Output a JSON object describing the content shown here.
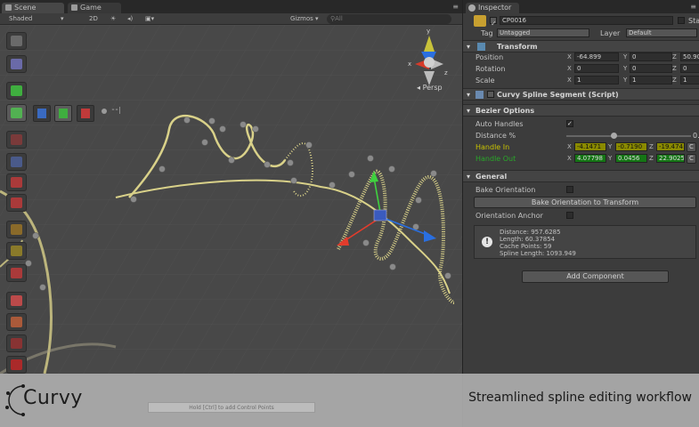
{
  "scene_tabs": {
    "scene": "Scene",
    "game": "Game"
  },
  "scene_toolbar": {
    "shading": "Shaded",
    "mode2d": "2D",
    "gizmos": "Gizmos ▾",
    "search_placeholder": "All"
  },
  "viewport": {
    "persp_label": "Persp"
  },
  "inspector": {
    "tab": "Inspector",
    "object_name": "CP0016",
    "static_label": "Sta",
    "tag_label": "Tag",
    "tag_value": "Untagged",
    "layer_label": "Layer",
    "layer_value": "Default",
    "transform": {
      "title": "Transform",
      "position": {
        "label": "Position",
        "x": "-64.899",
        "y": "0",
        "z": "50.90"
      },
      "rotation": {
        "label": "Rotation",
        "x": "0",
        "y": "0",
        "z": "0"
      },
      "scale": {
        "label": "Scale",
        "x": "1",
        "y": "1",
        "z": "1"
      }
    },
    "segment_title": "Curvy Spline Segment (Script)",
    "bezier": {
      "title": "Bezier Options",
      "auto_handles": "Auto Handles",
      "distance": "Distance %",
      "distance_value": "0.",
      "handle_in": {
        "label": "Handle In",
        "x": "-4.1471",
        "y": "-0.7190",
        "z": "-19.474"
      },
      "handle_out": {
        "label": "Handle Out",
        "x": "4.07798",
        "y": "0.0456",
        "z": "22.9025"
      }
    },
    "general": {
      "title": "General",
      "bake_orientation": "Bake Orientation",
      "bake_button": "Bake Orientation to Transform",
      "orientation_anchor": "Orientation Anchor",
      "info": [
        "Distance: 957.6285",
        "Length: 60.37854",
        "Cache Points: 59",
        "Spline Length: 1093.949"
      ]
    },
    "add_component": "Add Component"
  },
  "banner": {
    "brand": "Curvy",
    "tagline": "Streamlined spline editing workflow",
    "hint": "Hold [Ctrl] to add Control Points"
  },
  "colors": {
    "spline": "#d9d189",
    "handle_in": "#c9c300",
    "handle_out": "#29a829"
  }
}
